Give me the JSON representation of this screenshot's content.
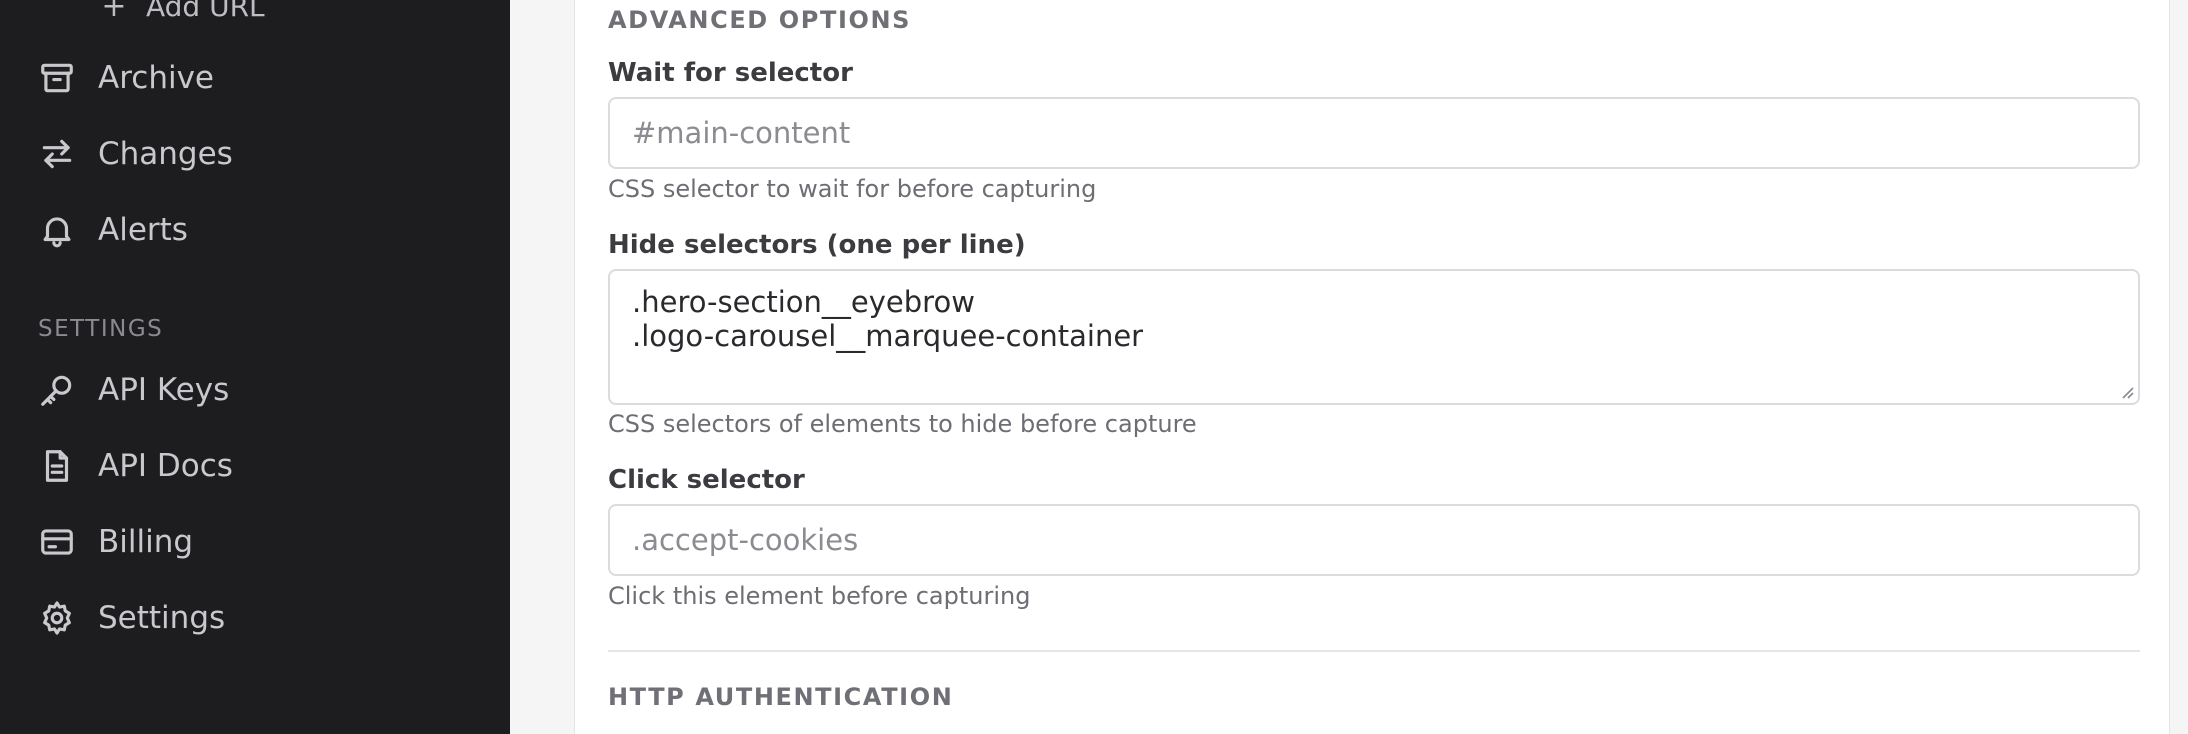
{
  "sidebar": {
    "add_url_label": "Add URL",
    "items": [
      {
        "label": "Archive",
        "icon": "archive-icon"
      },
      {
        "label": "Changes",
        "icon": "arrows-exchange-icon"
      },
      {
        "label": "Alerts",
        "icon": "bell-icon"
      }
    ],
    "settings_section_label": "SETTINGS",
    "settings_items": [
      {
        "label": "API Keys",
        "icon": "key-icon"
      },
      {
        "label": "API Docs",
        "icon": "document-icon"
      },
      {
        "label": "Billing",
        "icon": "credit-card-icon"
      },
      {
        "label": "Settings",
        "icon": "gear-icon"
      }
    ]
  },
  "advanced": {
    "heading": "ADVANCED OPTIONS",
    "wait_label": "Wait for selector",
    "wait_placeholder": "#main-content",
    "wait_help": "CSS selector to wait for before capturing",
    "hide_label": "Hide selectors (one per line)",
    "hide_lines": [
      ".hero-section__eyebrow",
      ".logo-carousel__marquee-container"
    ],
    "hide_help": "CSS selectors of elements to hide before capture",
    "click_label": "Click selector",
    "click_placeholder": ".accept-cookies",
    "click_help": "Click this element before capturing"
  },
  "http_auth": {
    "heading": "HTTP AUTHENTICATION"
  },
  "colors": {
    "sidebar_bg": "#1d1d1f",
    "main_bg": "#f5f5f6",
    "card_bg": "#ffffff"
  }
}
